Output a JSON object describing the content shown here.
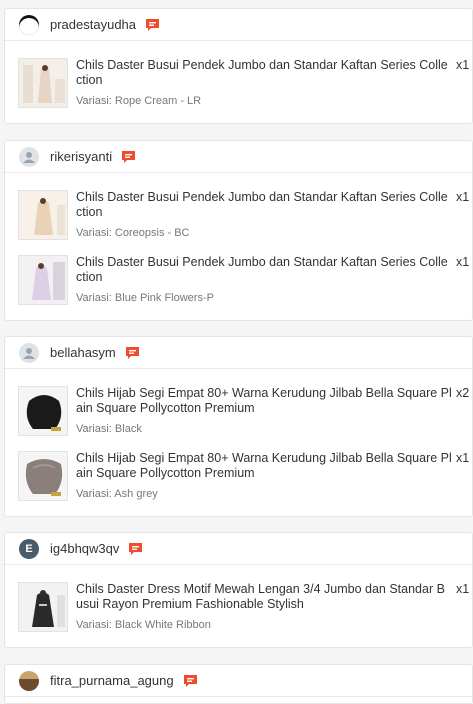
{
  "orders": [
    {
      "username": "pradestayudha",
      "avatar": "black-circle",
      "items": [
        {
          "title": "Chils Daster Busui Pendek Jumbo dan Standar Kaftan Series Colle ction",
          "variant": "Variasi: Rope Cream - LR",
          "qty": "x1",
          "thumb_color": "#e6d4c4"
        }
      ]
    },
    {
      "username": "rikerisyanti",
      "avatar": "default-user",
      "items": [
        {
          "title": "Chils Daster Busui Pendek Jumbo dan Standar Kaftan Series Colle ction",
          "variant": "Variasi: Coreopsis - BC",
          "qty": "x1",
          "thumb_color": "#e8d3b6"
        },
        {
          "title": "Chils Daster Busui Pendek Jumbo dan Standar Kaftan Series Colle ction",
          "variant": "Variasi: Blue Pink Flowers-P",
          "qty": "x1",
          "thumb_color": "#dcd0e6"
        }
      ]
    },
    {
      "username": "bellahasym",
      "avatar": "default-user",
      "items": [
        {
          "title": "Chils Hijab Segi Empat 80+ Warna Kerudung Jilbab Bella Square Pl ain Square Pollycotton Premium",
          "variant": "Variasi: Black",
          "qty": "x2",
          "thumb_color": "#1a1a1a"
        },
        {
          "title": "Chils Hijab Segi Empat 80+ Warna Kerudung Jilbab Bella Square Pl ain Square Pollycotton Premium",
          "variant": "Variasi: Ash grey",
          "qty": "x1",
          "thumb_color": "#8a7f7a"
        }
      ]
    },
    {
      "username": "ig4bhqw3qv",
      "avatar": "letter",
      "avatar_letter": "E",
      "items": [
        {
          "title": "Chils Daster Dress Motif Mewah Lengan 3/4 Jumbo dan Standar B usui Rayon Premium Fashionable Stylish",
          "variant": "Variasi: Black White Ribbon",
          "qty": "x1",
          "thumb_color": "#2a2a2a"
        }
      ]
    },
    {
      "username": "fitra_purnama_agung",
      "avatar": "photo",
      "items": []
    }
  ],
  "colors": {
    "chat_icon": "#ee4d2d",
    "border": "#e4e4e4"
  }
}
